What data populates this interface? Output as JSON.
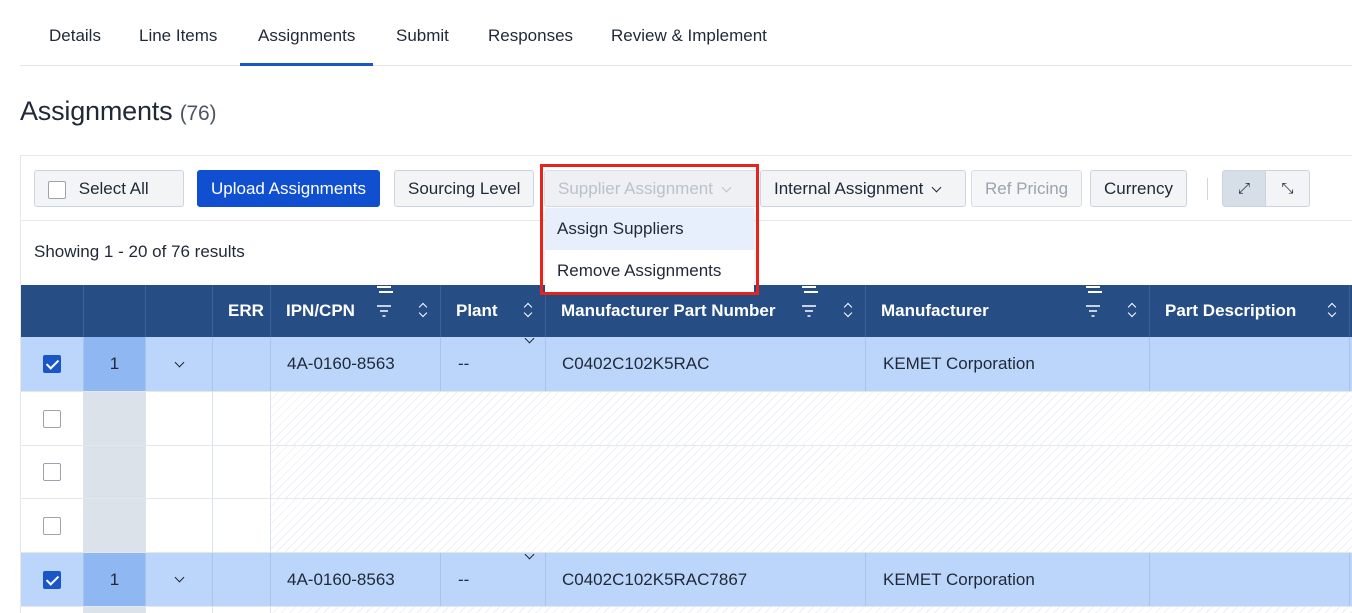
{
  "tabs": [
    {
      "label": "Details"
    },
    {
      "label": "Line Items"
    },
    {
      "label": "Assignments",
      "active": true
    },
    {
      "label": "Submit"
    },
    {
      "label": "Responses"
    },
    {
      "label": "Review & Implement"
    }
  ],
  "page": {
    "title": "Assignments",
    "count": "(76)"
  },
  "toolbar": {
    "select_all": "Select All",
    "upload": "Upload Assignments",
    "sourcing": "Sourcing Level",
    "supplier": "Supplier Assignment",
    "internal": "Internal Assignment",
    "ref_pricing": "Ref Pricing",
    "currency": "Currency"
  },
  "showing": "Showing 1 - 20 of 76 results",
  "columns": {
    "err": "ERR",
    "ipn": "IPN/CPN",
    "plant": "Plant",
    "mpn": "Manufacturer Part Number",
    "manufacturer": "Manufacturer",
    "desc": "Part Description"
  },
  "rows": [
    {
      "num": "1",
      "ipn": "4A-0160-8563",
      "plant": "--",
      "mpn": "C0402C102K5RAC",
      "manufacturer": "KEMET Corporation"
    },
    {
      "num": "1",
      "ipn": "4A-0160-8563",
      "plant": "--",
      "mpn": "C0402C102K5RAC7867",
      "manufacturer": "KEMET Corporation"
    }
  ],
  "menu": {
    "items": [
      {
        "label": "Assign Suppliers"
      },
      {
        "label": "Remove Assignments"
      }
    ]
  },
  "colors": {
    "primary": "#0f4fd0",
    "header": "#274e84",
    "selected_row": "#bcd5fb",
    "highlight": "#e8231b"
  }
}
